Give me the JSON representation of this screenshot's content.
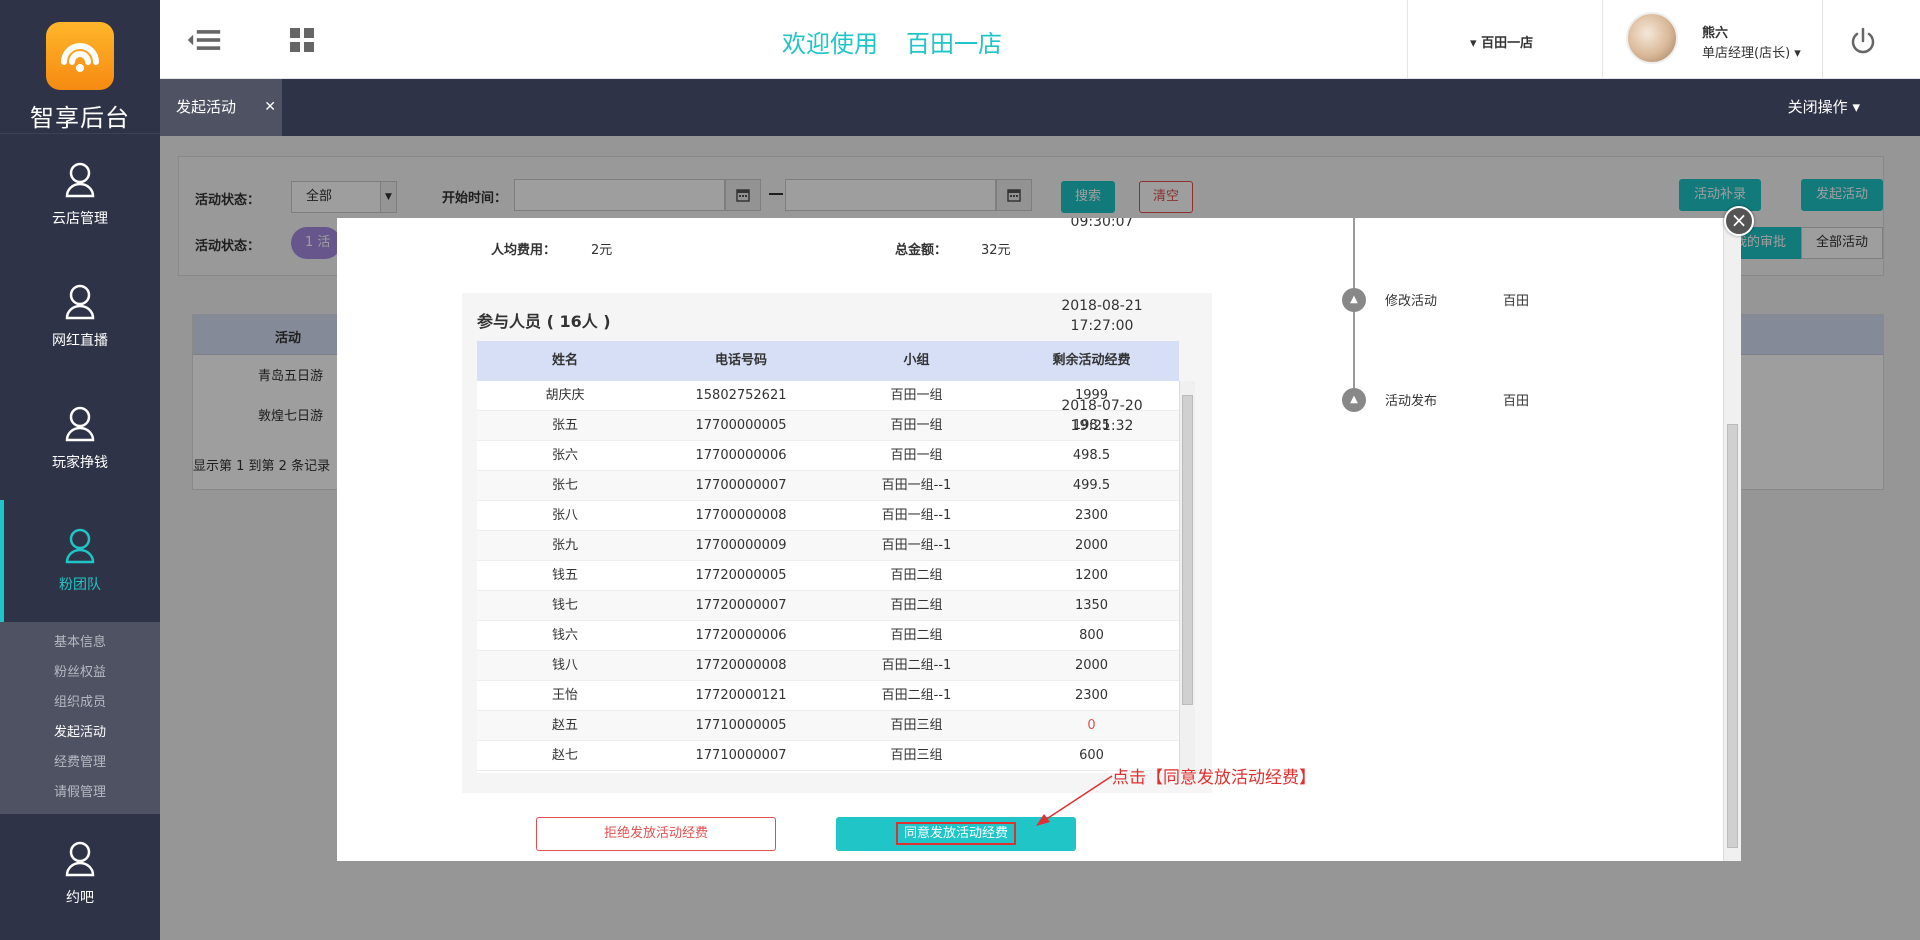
{
  "brand": {
    "name": "智享后台",
    "badge_color": "#f59a18"
  },
  "colors": {
    "accent": "#20c5c7",
    "sidebar": "#2f3347",
    "danger": "#e05050"
  },
  "sidebar": {
    "items": [
      {
        "label": "云店管理",
        "icon": "user-icon"
      },
      {
        "label": "网红直播",
        "icon": "user-icon"
      },
      {
        "label": "玩家挣钱",
        "icon": "user-icon"
      },
      {
        "label": "粉团队",
        "icon": "user-icon",
        "active": true
      },
      {
        "label": "约吧",
        "icon": "user-icon"
      }
    ],
    "submenu": [
      "基本信息",
      "粉丝权益",
      "组织成员",
      "发起活动",
      "经费管理",
      "请假管理"
    ],
    "submenu_active": "发起活动"
  },
  "header": {
    "welcome": "欢迎使用",
    "store": "百田一店",
    "store_switch": "百田一店",
    "user_name": "熊六",
    "user_role": "单店经理(店长)"
  },
  "tabbar": {
    "active_tab": "发起活动",
    "close_ops": "关闭操作"
  },
  "filters": {
    "status_label": "活动状态：",
    "status_value": "全部",
    "start_time_label": "开始时间：",
    "search": "搜索",
    "clear": "清空",
    "status_label_2": "活动状态：",
    "pill_text": "1 活",
    "supplement": "活动补录",
    "launch": "发起活动",
    "my_approval": "我的审批",
    "all_activities": "全部活动"
  },
  "bg_table": {
    "header": "活动",
    "rows": [
      "青岛五日游",
      "敦煌七日游"
    ],
    "footer": "显示第 1 到第 2 条记录"
  },
  "modal": {
    "per_cost_label": "人均费用：",
    "per_cost_value": "2元",
    "total_label": "总金额：",
    "total_value": "32元",
    "participants_title": "参与人员 ( 16人 )",
    "columns": [
      "姓名",
      "电话号码",
      "小组",
      "剩余活动经费"
    ],
    "rows": [
      [
        "胡庆庆",
        "15802752621",
        "百田一组",
        "1999"
      ],
      [
        "张五",
        "17700000005",
        "百田一组",
        "198.5"
      ],
      [
        "张六",
        "17700000006",
        "百田一组",
        "498.5"
      ],
      [
        "张七",
        "17700000007",
        "百田一组--1",
        "499.5"
      ],
      [
        "张八",
        "17700000008",
        "百田一组--1",
        "2300"
      ],
      [
        "张九",
        "17700000009",
        "百田一组--1",
        "2000"
      ],
      [
        "钱五",
        "17720000005",
        "百田二组",
        "1200"
      ],
      [
        "钱七",
        "17720000007",
        "百田二组",
        "1350"
      ],
      [
        "钱六",
        "17720000006",
        "百田二组",
        "800"
      ],
      [
        "钱八",
        "17720000008",
        "百田二组--1",
        "2000"
      ],
      [
        "王怡",
        "17720000121",
        "百田二组--1",
        "2300"
      ],
      [
        "赵五",
        "17710000005",
        "百田三组",
        "0"
      ],
      [
        "赵七",
        "17710000007",
        "百田三组",
        "600"
      ]
    ],
    "timeline": [
      {
        "date": "09:30:07",
        "time": "",
        "action": "",
        "who": ""
      },
      {
        "date": "2018-08-21",
        "time": "17:27:00",
        "action": "修改活动",
        "who": "百田"
      },
      {
        "date": "2018-07-20",
        "time": "19:21:32",
        "action": "活动发布",
        "who": "百田"
      }
    ],
    "reject_label": "拒绝发放活动经费",
    "agree_label": "同意发放活动经费"
  },
  "annotation": "点击【同意发放活动经费】"
}
